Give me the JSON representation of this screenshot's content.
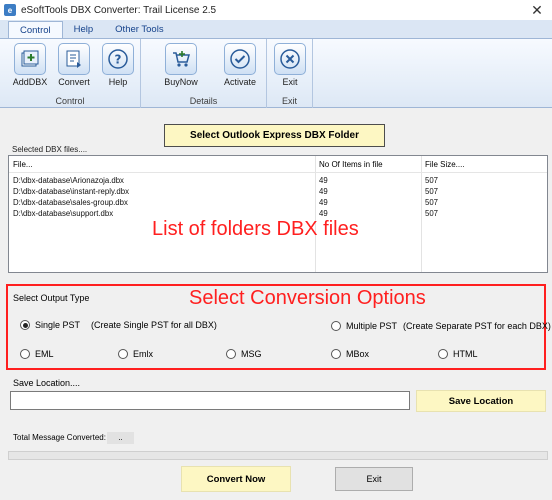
{
  "window": {
    "title": "eSoftTools DBX Converter: Trail License 2.5",
    "close_label": "✕"
  },
  "tabs": [
    {
      "label": "Control",
      "active": true
    },
    {
      "label": "Help",
      "active": false
    },
    {
      "label": "Other Tools",
      "active": false
    }
  ],
  "ribbon": {
    "groups": [
      {
        "label": "Control",
        "buttons": [
          {
            "label": "AddDBX",
            "icon": "add-dbx-icon"
          },
          {
            "label": "Convert",
            "icon": "convert-icon"
          },
          {
            "label": "Help",
            "icon": "help-icon"
          }
        ]
      },
      {
        "label": "Details",
        "buttons": [
          {
            "label": "BuyNow",
            "icon": "cart-icon"
          },
          {
            "label": "Activate",
            "icon": "check-icon"
          }
        ]
      },
      {
        "label": "Exit",
        "buttons": [
          {
            "label": "Exit",
            "icon": "close-icon"
          }
        ]
      }
    ]
  },
  "select_folder_label": "Select Outlook Express DBX Folder",
  "file_section_caption": "Selected DBX files....",
  "file_table": {
    "columns": [
      "File...",
      "No Of Items in file",
      "File Size...."
    ],
    "rows": [
      {
        "file": "D:\\dbx-database\\Arionazoja.dbx",
        "items": "49",
        "size": "507"
      },
      {
        "file": "D:\\dbx-database\\instant-reply.dbx",
        "items": "49",
        "size": "507"
      },
      {
        "file": "D:\\dbx-database\\sales-group.dbx",
        "items": "49",
        "size": "507"
      },
      {
        "file": "D:\\dbx-database\\support.dbx",
        "items": "49",
        "size": "507"
      }
    ]
  },
  "annotations": {
    "list": "List of folders DBX files",
    "options": "Select Conversion Options"
  },
  "output": {
    "title": "Select Output Type",
    "single_pst": {
      "label": "Single PST",
      "desc": "(Create Single PST for all DBX)",
      "selected": true
    },
    "multiple_pst": {
      "label": "Multiple PST",
      "desc": "(Create Separate PST for each DBX)",
      "selected": false
    },
    "formats": [
      {
        "label": "EML",
        "selected": false
      },
      {
        "label": "Emlx",
        "selected": false
      },
      {
        "label": "MSG",
        "selected": false
      },
      {
        "label": "MBox",
        "selected": false
      },
      {
        "label": "HTML",
        "selected": false
      }
    ]
  },
  "save": {
    "label": "Save Location....",
    "value": "",
    "button_label": "Save Location"
  },
  "total": {
    "label": "Total Message Converted:",
    "value": ".."
  },
  "progress_fraction": 0.0,
  "actions": {
    "convert_label": "Convert Now",
    "exit_label": "Exit"
  },
  "colors": {
    "annotation": "#ff1f1f",
    "button_yellow": "#fdf7c3",
    "ribbon_blue": "#dbe6f4"
  }
}
